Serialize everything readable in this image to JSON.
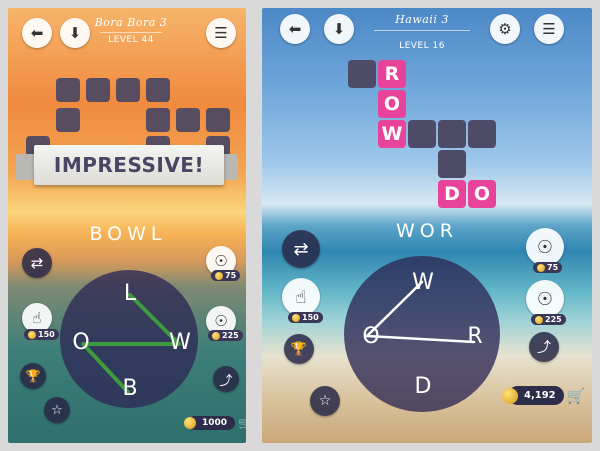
{
  "left": {
    "title": "Bora Bora 3",
    "level": "LEVEL 44",
    "praise": "IMPRESSIVE!",
    "current_word": "BOWL",
    "letters": [
      "L",
      "O",
      "W",
      "B"
    ],
    "hint_count": "75",
    "multi_hint_count": "225",
    "finger_hint_count": "150",
    "coins": "1000",
    "colors": {
      "accent": "#4e4b68",
      "trace": "#3d9a3f"
    }
  },
  "right": {
    "title": "Hawaii 3",
    "level": "LEVEL 16",
    "current_word": "WOR",
    "letters": [
      "W",
      "O",
      "R",
      "D"
    ],
    "solved_row": [
      "R",
      "O",
      "W"
    ],
    "solved_do": [
      "D",
      "O"
    ],
    "hint_count": "75",
    "multi_hint_count": "225",
    "finger_hint_count": "150",
    "coins": "4,192",
    "colors": {
      "accent": "#e8439b",
      "trace": "#ffffff"
    }
  },
  "icons": {
    "back": "back-arrow-icon",
    "download": "download-icon",
    "menu": "menu-icon",
    "shuffle": "shuffle-icon",
    "bulb": "lightbulb-icon",
    "finger": "finger-tap-icon",
    "trophy": "trophy-icon",
    "star": "star-icon",
    "share": "share-icon",
    "cart": "cart-icon"
  }
}
